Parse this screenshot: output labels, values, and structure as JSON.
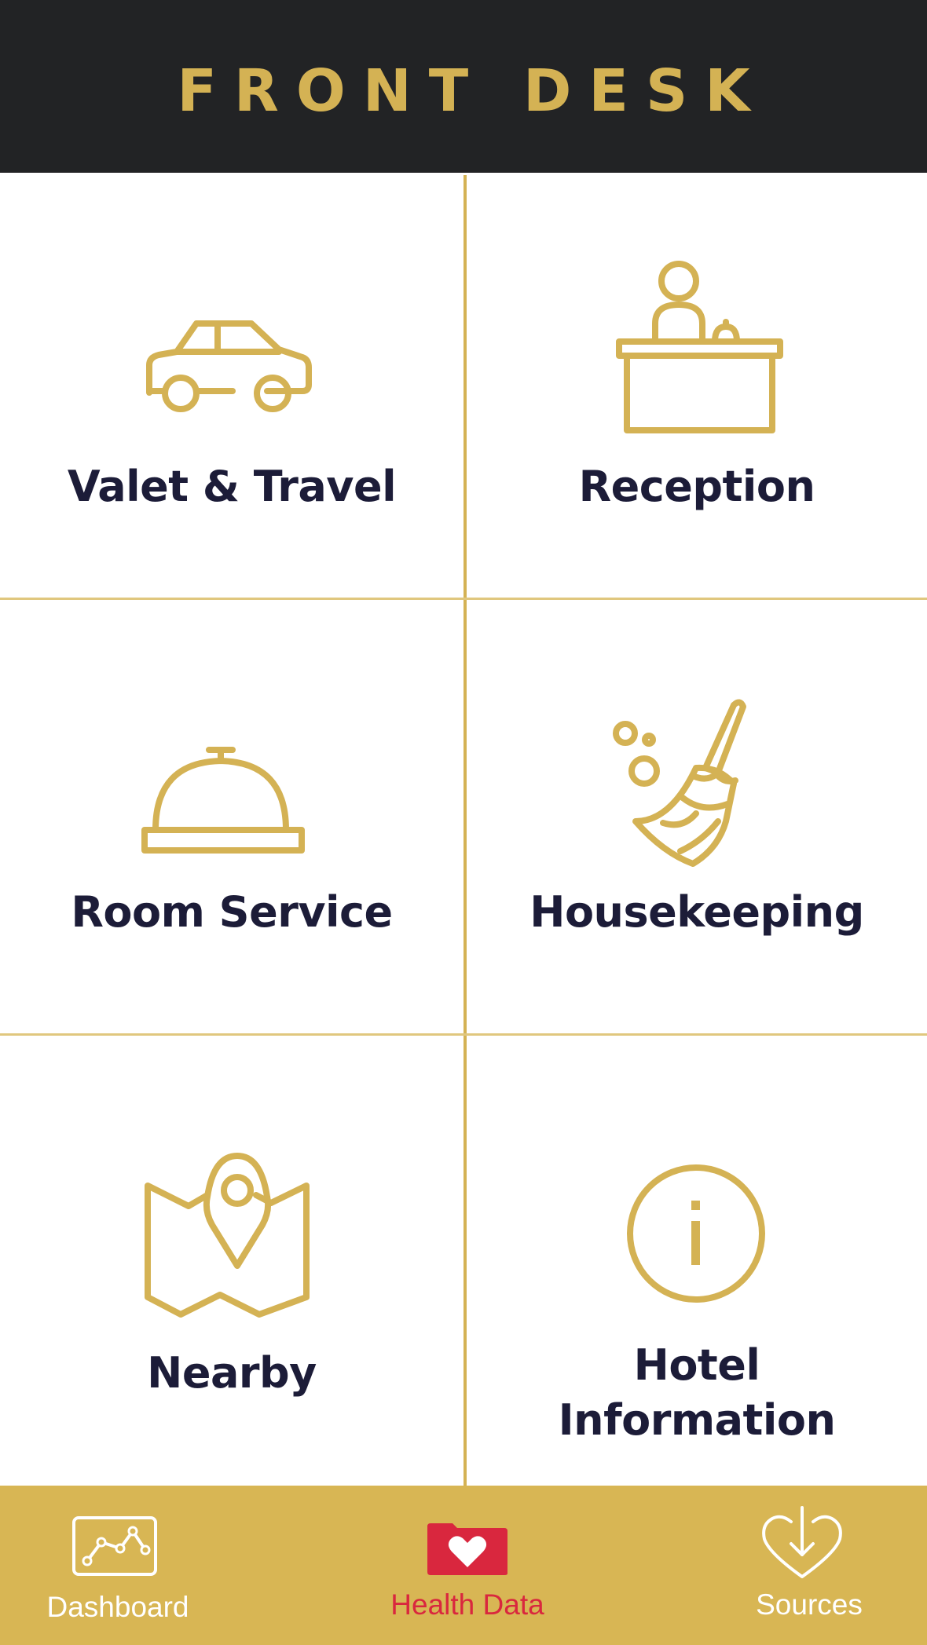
{
  "header": {
    "title": "FRONT DESK"
  },
  "colors": {
    "header_bg": "#222325",
    "gold": "#d4b254",
    "tabbar_bg": "#d8b654",
    "label_text": "#1c1c38",
    "active_tab": "#d9273e",
    "inactive_tab": "#ffffff"
  },
  "tiles": [
    {
      "label": "Valet & Travel",
      "icon": "car-icon"
    },
    {
      "label": "Reception",
      "icon": "reception-desk-icon"
    },
    {
      "label": "Room Service",
      "icon": "cloche-icon"
    },
    {
      "label": "Housekeeping",
      "icon": "broom-icon"
    },
    {
      "label": "Nearby",
      "icon": "map-pin-icon"
    },
    {
      "label": "Hotel",
      "label_line2": "Information",
      "icon": "info-icon"
    }
  ],
  "tabbar": {
    "tabs": [
      {
        "label": "Dashboard",
        "icon": "chart-icon",
        "active": false
      },
      {
        "label": "Health Data",
        "icon": "heart-folder-icon",
        "active": true
      },
      {
        "label": "Sources",
        "icon": "heart-download-icon",
        "active": false
      }
    ]
  }
}
